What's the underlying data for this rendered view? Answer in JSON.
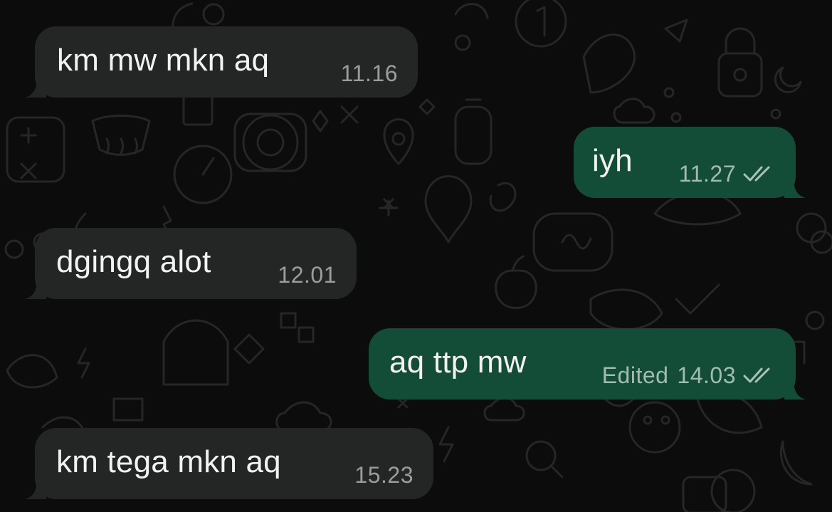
{
  "messages": [
    {
      "id": "m1",
      "direction": "incoming",
      "text": "km mw mkn aq",
      "time": "11.16"
    },
    {
      "id": "m2",
      "direction": "outgoing",
      "text": "iyh",
      "time": "11.27",
      "status": "read-double-check-icon"
    },
    {
      "id": "m3",
      "direction": "incoming",
      "text": "dgingq alot",
      "time": "12.01"
    },
    {
      "id": "m4",
      "direction": "outgoing",
      "text": "aq ttp mw",
      "edited_label": "Edited",
      "time": "14.03",
      "status": "read-double-check-icon"
    },
    {
      "id": "m5",
      "direction": "incoming",
      "text": "km tega mkn aq",
      "time": "15.23"
    }
  ],
  "colors": {
    "background": "#0c0c0c",
    "incoming_bubble": "#242626",
    "outgoing_bubble": "#144d37",
    "doodle_stroke": "#2a2a2a"
  }
}
